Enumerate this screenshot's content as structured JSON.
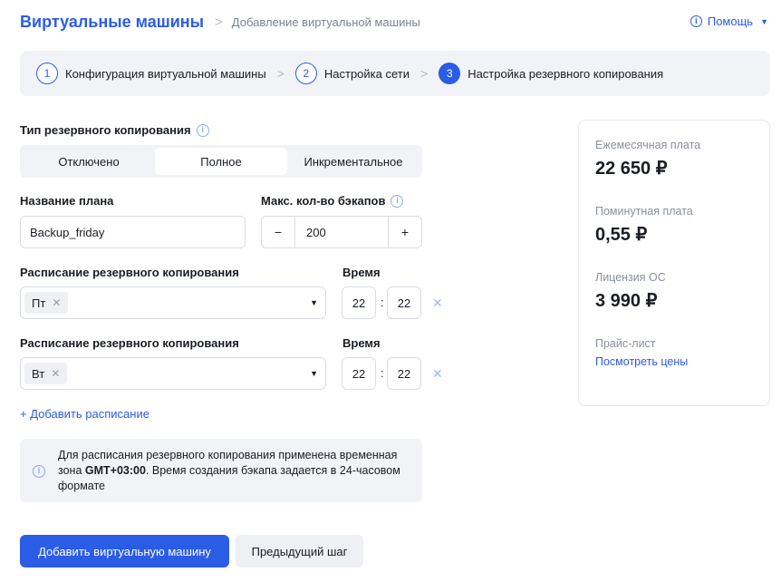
{
  "header": {
    "root": "Виртуальные машины",
    "separator": ">",
    "current": "Добавление виртуальной машины",
    "help_label": "Помощь"
  },
  "steps": [
    {
      "num": "1",
      "label": "Конфигурация виртуальной машины"
    },
    {
      "num": "2",
      "label": "Настройка сети"
    },
    {
      "num": "3",
      "label": "Настройка резервного копирования"
    }
  ],
  "backup_type": {
    "label": "Тип резервного копирования",
    "options": [
      "Отключено",
      "Полное",
      "Инкрементальное"
    ],
    "selected": "Полное"
  },
  "plan_name": {
    "label": "Название плана",
    "value": "Backup_friday"
  },
  "max_backups": {
    "label": "Макс. кол-во бэкапов",
    "value": "200",
    "minus": "−",
    "plus": "+"
  },
  "schedules": [
    {
      "label": "Расписание резервного копирования",
      "time_label": "Время",
      "day": "Пт",
      "hour": "22",
      "minute": "22"
    },
    {
      "label": "Расписание резервного копирования",
      "time_label": "Время",
      "day": "Вт",
      "hour": "22",
      "minute": "22"
    }
  ],
  "add_schedule": "+ Добавить расписание",
  "note": {
    "text_before": "Для расписания резервного копирования применена временная зона ",
    "timezone": "GMT+03:00",
    "text_after": ". Время создания бэкапа задается в 24-часовом формате"
  },
  "buttons": {
    "primary": "Добавить виртуальную машину",
    "secondary": "Предыдущий шаг"
  },
  "prices": {
    "monthly_label": "Ежемесячная плата",
    "monthly_value": "22 650 ₽",
    "minute_label": "Поминутная плата",
    "minute_value": "0,55 ₽",
    "os_label": "Лицензия ОС",
    "os_value": "3 990 ₽",
    "pricelist_label": "Прайс-лист",
    "pricelist_link": "Посмотреть цены"
  },
  "colors": {
    "accent": "#2b5ce6",
    "panel": "#f1f3f6"
  }
}
